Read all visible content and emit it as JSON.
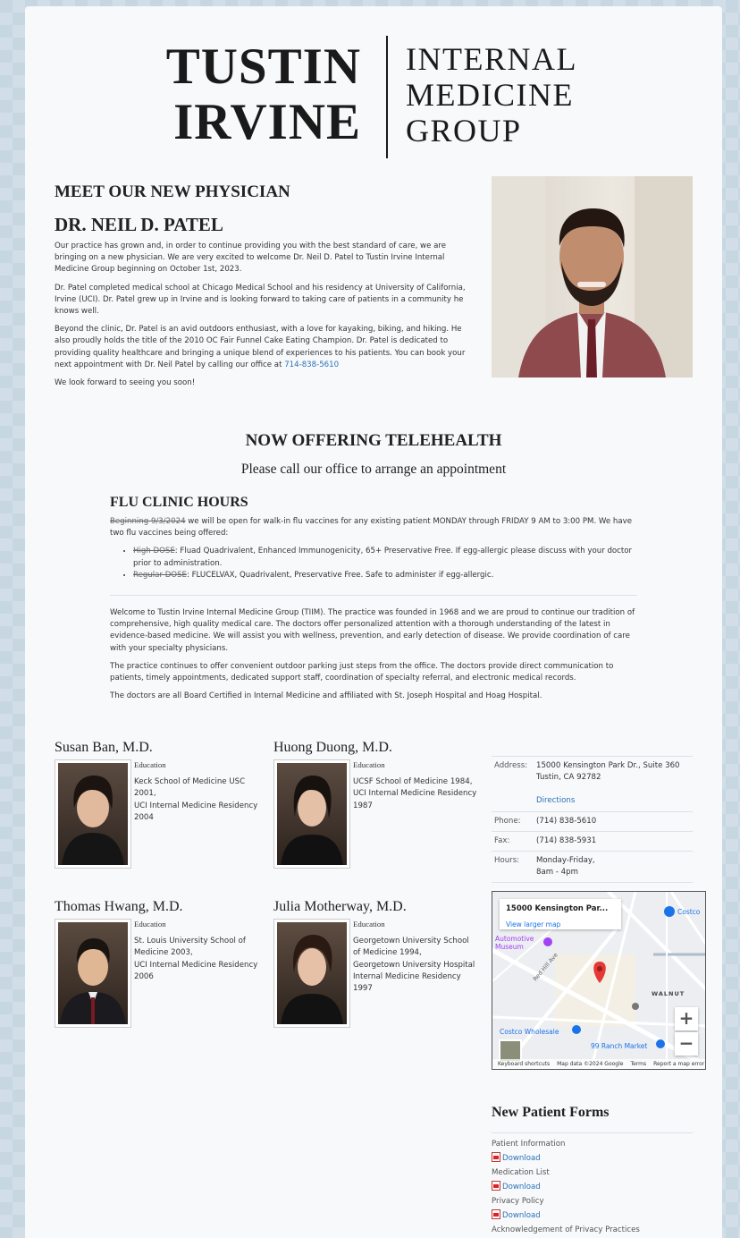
{
  "logo": {
    "left_line1": "TUSTIN",
    "left_line2": "IRVINE",
    "right_line1": "INTERNAL",
    "right_line2": "MEDICINE",
    "right_line3": "GROUP"
  },
  "intro": {
    "heading1": "MEET OUR NEW PHYSICIAN",
    "heading2": "DR. NEIL D. PATEL",
    "p1": "Our practice has grown and, in order to continue providing you with the best standard of care, we are bringing on a new physician. We are very excited to welcome Dr. Neil D. Patel to Tustin Irvine Internal Medicine Group beginning on October 1st, 2023.",
    "p2": "Dr. Patel completed medical school at Chicago Medical School and his residency at University of California, Irvine (UCI). Dr. Patel grew up in Irvine and is looking forward to taking care of patients in a community he knows well.",
    "p3": "Beyond the clinic, Dr. Patel is an avid outdoors enthusiast, with a love for kayaking, biking, and hiking. He also proudly holds the title of the 2010 OC Fair Funnel Cake Eating Champion. Dr. Patel is dedicated to providing quality healthcare and bringing a unique blend of experiences to his patients. You can book your next appointment with Dr. Neil Patel by calling our office at",
    "phone_link": "714-838-5610",
    "p4": "We look forward to seeing you soon!"
  },
  "telehealth": {
    "title": "NOW OFFERING TELEHEALTH",
    "subtitle": "Please call our office to arrange an appointment"
  },
  "flu": {
    "title": "FLU CLINIC HOURS",
    "intro_lead": "Beginning 9/3/2024",
    "intro_rest": " we will be open for walk-in flu vaccines for any existing patient MONDAY through FRIDAY 9 AM to 3:00 PM. We have two flu vaccines being offered:",
    "item1_lead": "High DOSE",
    "item1_rest": ": Fluad Quadrivalent, Enhanced Immunogenicity, 65+ Preservative Free. If egg-allergic please discuss with your doctor prior to administration.",
    "item2_lead": "Regular DOSE",
    "item2_rest": ": FLUCELVAX, Quadrivalent, Preservative Free. Safe to administer if egg-allergic."
  },
  "welcome": {
    "p1": "Welcome to Tustin Irvine Internal Medicine Group (TIIM). The practice was founded in 1968 and we are proud to continue our tradition of comprehensive, high quality medical care. The doctors offer personalized attention with a thorough understanding of the latest in evidence-based medicine. We will assist you with wellness, prevention, and early detection of disease. We provide coordination of care with your specialty physicians.",
    "p2": "The practice continues to offer convenient outdoor parking just steps from the office. The doctors provide direct communication to patients, timely appointments, dedicated support staff, coordination of specialty referral, and electronic medical records.",
    "p3": "The doctors are all Board Certified in Internal Medicine and affiliated with St. Joseph Hospital and Hoag Hospital."
  },
  "doctors": [
    {
      "name": "Susan Ban, M.D.",
      "edu_label": "Education",
      "edu": "Keck School of Medicine USC 2001,\nUCI Internal Medicine Residency 2004"
    },
    {
      "name": "Huong Duong, M.D.",
      "edu_label": "Education",
      "edu": "UCSF School of Medicine 1984,\nUCI Internal Medicine Residency 1987"
    },
    {
      "name": "Thomas Hwang, M.D.",
      "edu_label": "Education",
      "edu": "St. Louis University School of Medicine 2003,\nUCI Internal Medicine Residency 2006"
    },
    {
      "name": "Julia Motherway, M.D.",
      "edu_label": "Education",
      "edu": "Georgetown University School of Medicine 1994,\nGeorgetown University Hospital Internal Medicine Residency 1997"
    }
  ],
  "contact": {
    "address_label": "Address:",
    "address_line1": "15000 Kensington Park Dr., Suite 360",
    "address_line2": "Tustin, CA 92782",
    "directions": "Directions",
    "phone_label": "Phone:",
    "phone": "(714) 838-5610",
    "fax_label": "Fax:",
    "fax": "(714) 838-5931",
    "hours_label": "Hours:",
    "hours_line1": "Monday-Friday,",
    "hours_line2": "8am - 4pm"
  },
  "map": {
    "card_title": "15000 Kensington Par...",
    "card_link": "View larger map",
    "label_costco": "Costco",
    "label_museum": "Automotive Museum",
    "label_walnut": "WALNUT",
    "label_redhill": "Red Hill Ave",
    "label_wholesale": "Costco Wholesale",
    "label_ranch": "99 Ranch Market",
    "zoom_in": "+",
    "zoom_out": "−",
    "footer_keyboard": "Keyboard shortcuts",
    "footer_data": "Map data ©2024 Google",
    "footer_terms": "Terms",
    "footer_report": "Report a map error"
  },
  "forms": {
    "title": "New Patient Forms",
    "items": [
      {
        "label": "Patient Information",
        "link": "Download"
      },
      {
        "label": "Medication List",
        "link": "Download"
      },
      {
        "label": "Privacy Policy",
        "link": "Download"
      },
      {
        "label": "Acknowledgement of Privacy Practices"
      }
    ]
  }
}
